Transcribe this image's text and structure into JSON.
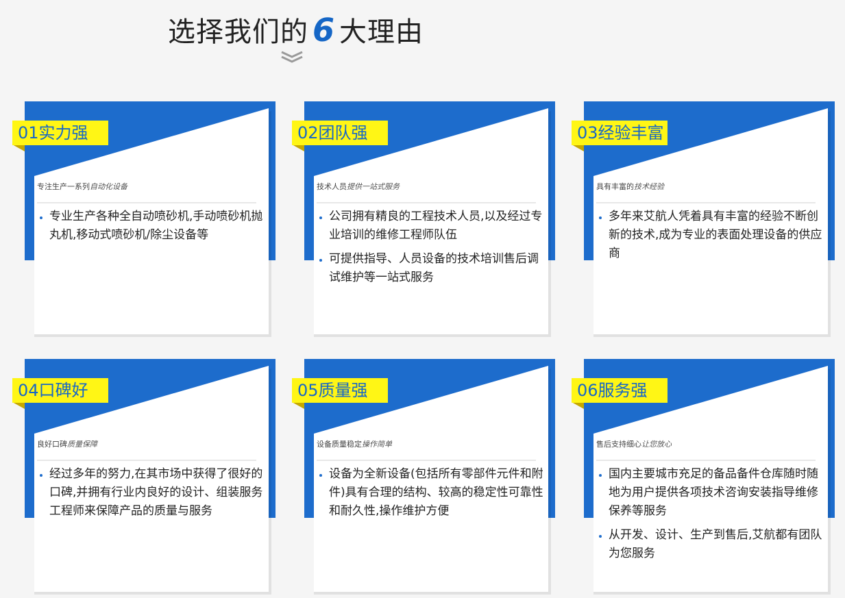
{
  "title": {
    "before": "选择我们的",
    "number": "6",
    "after": "大理由"
  },
  "cards": [
    {
      "tab": "01实力强",
      "subtitle_plain": "专注生产一系列",
      "subtitle_italic": "自动化设备",
      "bullets": [
        "专业生产各种全自动喷砂机,手动喷砂机抛丸机,移动式喷砂机/除尘设备等"
      ]
    },
    {
      "tab": "02团队强",
      "subtitle_plain": "技术人员",
      "subtitle_italic": "提供一站式服务",
      "bullets": [
        "公司拥有精良的工程技术人员,以及经过专业培训的维修工程师队伍",
        "可提供指导、人员设备的技术培训售后调试维护等一站式服务"
      ]
    },
    {
      "tab": "03经验丰富",
      "subtitle_plain": "具有丰富的",
      "subtitle_italic": "技术经验",
      "bullets": [
        "多年来艾航人凭着具有丰富的经验不断创新的技术,成为专业的表面处理设备的供应商"
      ]
    },
    {
      "tab": "04口碑好",
      "subtitle_plain": "良好口碑",
      "subtitle_italic": "质量保障",
      "bullets": [
        "经过多年的努力,在其市场中获得了很好的口碑,并拥有行业内良好的设计、组装服务工程师来保障产品的质量与服务"
      ]
    },
    {
      "tab": "05质量强",
      "subtitle_plain": "设备质量稳定",
      "subtitle_italic": "操作简单",
      "bullets": [
        "设备为全新设备(包括所有零部件元件和附件)具有合理的结构、较高的稳定性可靠性和耐久性,操作维护方便"
      ]
    },
    {
      "tab": "06服务强",
      "subtitle_plain": "售后支持细心",
      "subtitle_italic": "让您放心",
      "bullets": [
        "国内主要城市充足的备品备件仓库随时随地为用户提供各项技术咨询安装指导维修保养等服务",
        "从开发、设计、生产到售后,艾航都有团队为您服务"
      ]
    }
  ]
}
